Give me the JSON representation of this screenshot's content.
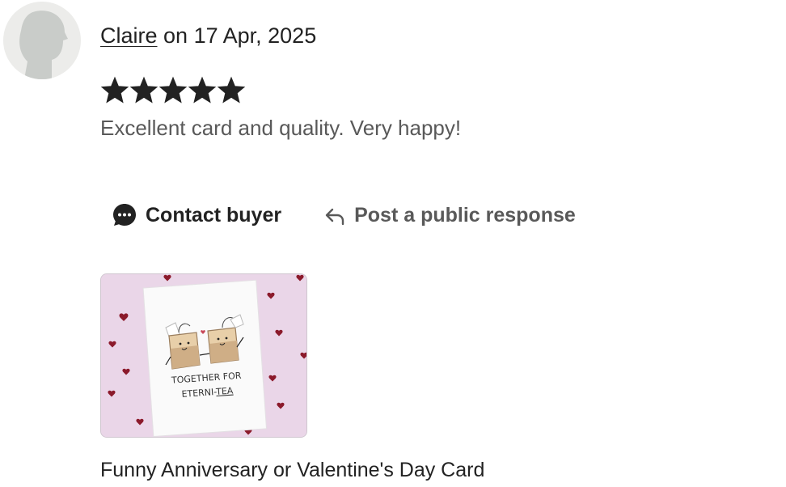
{
  "review": {
    "reviewer_name": "Claire",
    "date_text": " on 17 Apr, 2025",
    "rating": 5,
    "rating_max": 5,
    "text": "Excellent card and quality. Very happy!"
  },
  "actions": {
    "contact_label": "Contact buyer",
    "respond_label": "Post a public response",
    "contact_icon": "chat-bubble-icon",
    "respond_icon": "reply-arrow-icon"
  },
  "product": {
    "card_line1": "TOGETHER FOR",
    "card_line2_prefix": "ETERNI-",
    "card_line2_emph": "TEA",
    "title": "Funny Anniversary or Valentine's Day Card"
  },
  "colors": {
    "text": "#222222",
    "muted": "#595959",
    "thumb_bg": "#ead6e8",
    "heart": "#8b1a2b"
  }
}
